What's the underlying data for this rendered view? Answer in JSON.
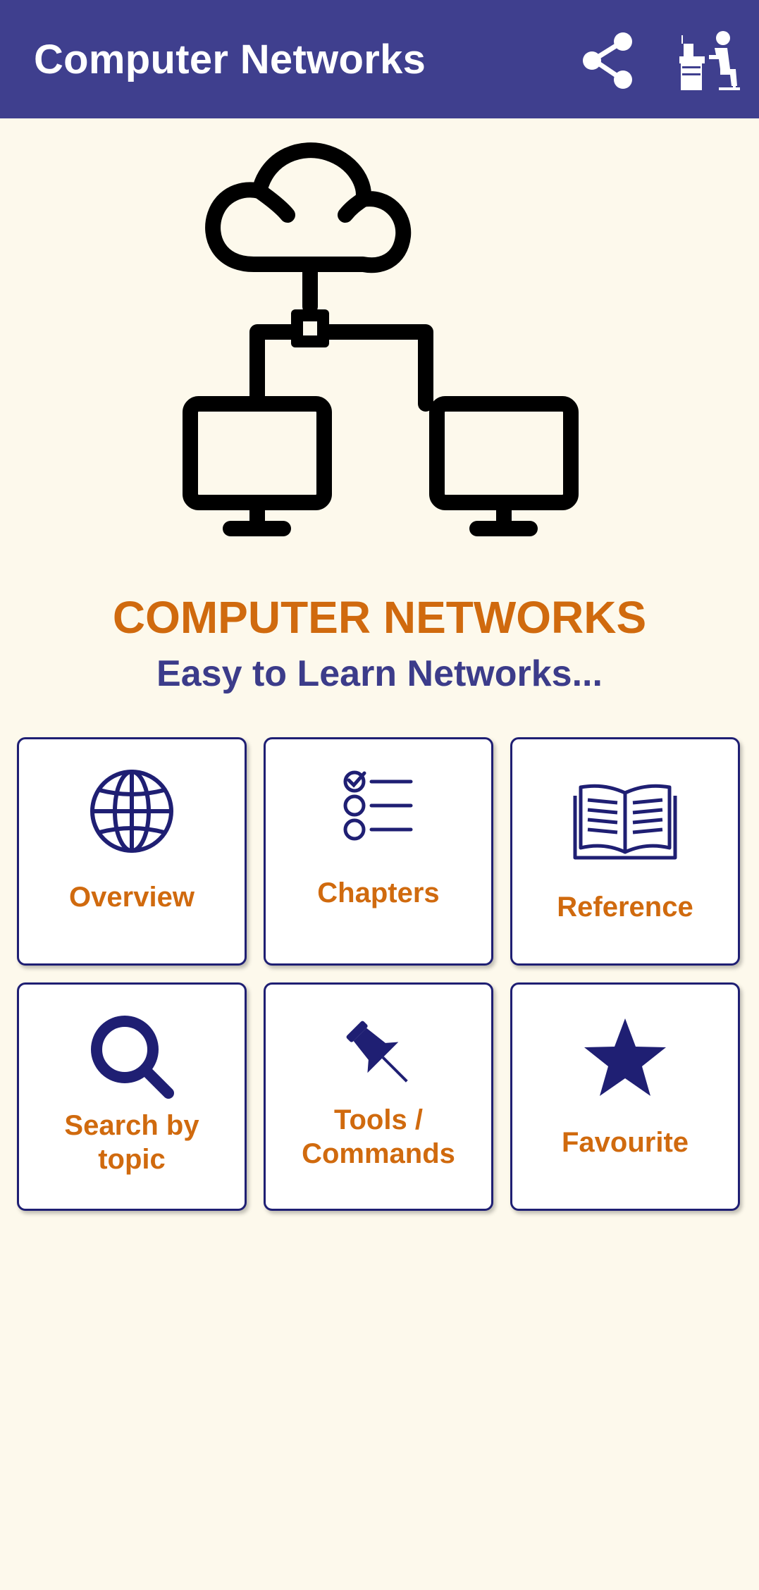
{
  "appbar": {
    "title": "Computer Networks",
    "share_icon": "share-icon",
    "profile_icon": "person-at-desk-icon",
    "color": "#3f3f8e"
  },
  "hero": {
    "icon": "cloud-network-icon",
    "title": "COMPUTER NETWORKS",
    "subtitle": "Easy to Learn Networks..."
  },
  "menu": {
    "overview": {
      "label": "Overview",
      "icon": "globe-icon"
    },
    "chapters": {
      "label": "Chapters",
      "icon": "checklist-icon"
    },
    "reference": {
      "label": "Reference",
      "icon": "open-book-icon"
    },
    "search": {
      "label_line1": "Search by",
      "label_line2": "topic",
      "icon": "search-icon"
    },
    "tools": {
      "label_line1": "Tools /",
      "label_line2": "Commands",
      "icon": "pushpin-icon"
    },
    "favourite": {
      "label": "Favourite",
      "icon": "star-icon"
    }
  },
  "colors": {
    "accent": "#d06a0e",
    "navy": "#1f1f73",
    "background": "#fdf9ec"
  }
}
